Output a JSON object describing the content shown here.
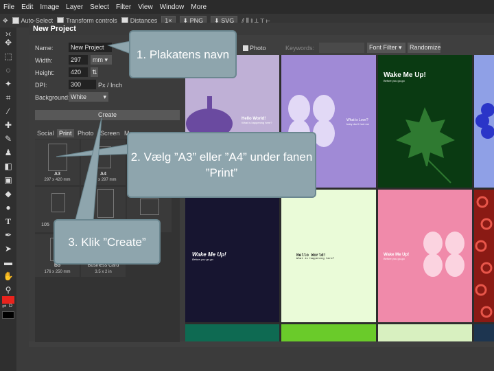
{
  "menu": {
    "items": [
      "File",
      "Edit",
      "Image",
      "Layer",
      "Select",
      "Filter",
      "View",
      "Window",
      "More"
    ]
  },
  "options_bar": {
    "auto_select": "Auto-Select",
    "transform_controls": "Transform controls",
    "distances": "Distances",
    "zoom": "1×",
    "png": "PNG",
    "svg": "SVG"
  },
  "dialog": {
    "title": "New Project",
    "name_label": "Name:",
    "name_value": "New Project",
    "width_label": "Width:",
    "width_value": "297",
    "width_unit": "mm",
    "height_label": "Height:",
    "height_value": "420",
    "dpi_label": "DPI:",
    "dpi_value": "300",
    "dpi_unit": "Px / Inch",
    "background_label": "Background:",
    "background_value": "White",
    "create_label": "Create",
    "tabs": [
      "Social",
      "Print",
      "Photo",
      "Screen",
      "M"
    ],
    "active_tab": "Print",
    "templates": [
      {
        "name": "A3",
        "size": "297 x 420 mm"
      },
      {
        "name": "A4",
        "size": "210 x 297 mm"
      },
      {
        "name": "105",
        "size": ""
      },
      {
        "name": "B5",
        "size": "176 x 250 mm"
      },
      {
        "name": "Business Card",
        "size": "3.5 x 2 in"
      }
    ]
  },
  "right_panel": {
    "photo_label": "Photo",
    "keywords_label": "Keywords:",
    "keywords_value": "",
    "font_filter": "Font Filter",
    "randomize": "Randomize"
  },
  "cards": {
    "hello_world": "Hello World!",
    "hello_sub": "What is happening here?",
    "what_love": "What is Love?",
    "what_love_sub": "baby don't hurt me",
    "wake_up": "Wake Me Up!",
    "wake_sub": "Before you go-go",
    "wake_up2": "Wake Me Up!",
    "wake_sub2": "Before you go-go",
    "hello_world2": "Hello World!",
    "hello_sub2": "What is happening here?",
    "wake_up3": "Wake Me Up!",
    "wake_sub3": "Before you go-go"
  },
  "callouts": {
    "c1": "1. Plakatens navn",
    "c2": "2. Vælg ”A3” eller ”A4” under fanen ”Print”",
    "c3": "3. Klik ”Create”"
  },
  "colors": {
    "foreground": "#e8231d",
    "background": "#000000",
    "callout": "#8ea5ad"
  }
}
